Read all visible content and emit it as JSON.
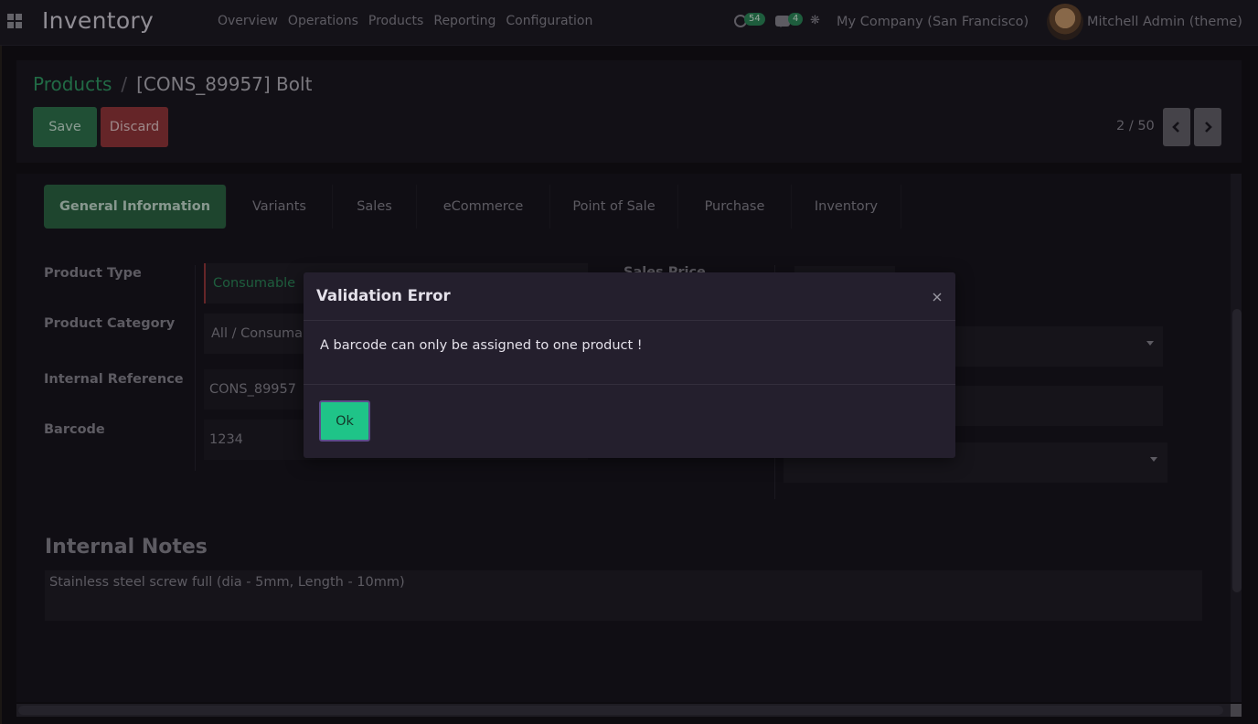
{
  "navbar": {
    "brand": "Inventory",
    "menu": [
      "Overview",
      "Operations",
      "Products",
      "Reporting",
      "Configuration"
    ],
    "activity_count": "54",
    "message_count": "4",
    "company": "My Company (San Francisco)",
    "user": "Mitchell Admin (theme)"
  },
  "breadcrumb": {
    "parent": "Products",
    "separator": "/",
    "current": "[CONS_89957] Bolt"
  },
  "toolbar": {
    "save_label": "Save",
    "discard_label": "Discard"
  },
  "pager": {
    "value": "2 / 50"
  },
  "tabs": [
    {
      "label": "General Information",
      "active": true
    },
    {
      "label": "Variants"
    },
    {
      "label": "Sales"
    },
    {
      "label": "eCommerce"
    },
    {
      "label": "Point of Sale"
    },
    {
      "label": "Purchase"
    },
    {
      "label": "Inventory"
    }
  ],
  "form": {
    "product_type_label": "Product Type",
    "product_type_value": "Consumable",
    "product_category_label": "Product Category",
    "product_category_value": "All / Consumable",
    "internal_reference_label": "Internal Reference",
    "internal_reference_value": "CONS_89957",
    "barcode_label": "Barcode",
    "barcode_value": "1234",
    "sales_price_label": "Sales Price"
  },
  "notes": {
    "title": "Internal Notes",
    "body": "Stainless steel screw full (dia - 5mm, Length - 10mm)"
  },
  "dialog": {
    "title": "Validation Error",
    "message": "A barcode can only be assigned to one product !",
    "ok_label": "Ok"
  },
  "colors": {
    "accent_green": "#34a36b",
    "ok_button": "#1fc488",
    "discard_red": "#9c3a3e"
  }
}
